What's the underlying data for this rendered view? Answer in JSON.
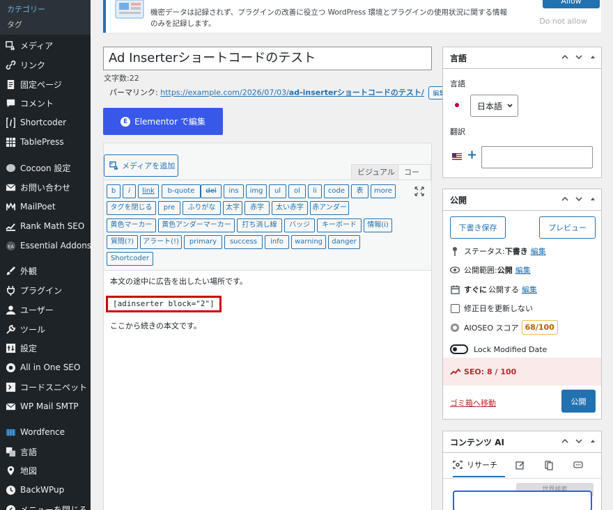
{
  "sidebar": {
    "submenu": [
      {
        "label": "カテゴリー",
        "active": true
      },
      {
        "label": "タグ",
        "active": false
      }
    ],
    "items": [
      {
        "label": "メディア",
        "icon": "media-icon"
      },
      {
        "label": "リンク",
        "icon": "link-icon"
      },
      {
        "label": "固定ページ",
        "icon": "page-icon"
      },
      {
        "label": "コメント",
        "icon": "comment-icon"
      },
      {
        "label": "Shortcoder",
        "icon": "shortcode-icon"
      },
      {
        "label": "TablePress",
        "icon": "table-icon"
      },
      {
        "label": "Cocoon 設定",
        "icon": "cocoon-icon"
      },
      {
        "label": "お問い合わせ",
        "icon": "mail-icon"
      },
      {
        "label": "MailPoet",
        "icon": "mailpoet-icon"
      },
      {
        "label": "Rank Math SEO",
        "icon": "rankmath-icon"
      },
      {
        "label": "Essential Addons",
        "icon": "ea-icon"
      },
      {
        "label": "外観",
        "icon": "brush-icon"
      },
      {
        "label": "プラグイン",
        "icon": "plugin-icon"
      },
      {
        "label": "ユーザー",
        "icon": "user-icon"
      },
      {
        "label": "ツール",
        "icon": "wrench-icon"
      },
      {
        "label": "設定",
        "icon": "settings-icon"
      },
      {
        "label": "All in One SEO",
        "icon": "aioseo-icon"
      },
      {
        "label": "コードスニペット",
        "icon": "snippet-icon"
      },
      {
        "label": "WP Mail SMTP",
        "icon": "smtp-icon"
      },
      {
        "label": "Wordfence",
        "icon": "wordfence-icon"
      },
      {
        "label": "言語",
        "icon": "translate-icon"
      },
      {
        "label": "地図",
        "icon": "map-pin-icon"
      },
      {
        "label": "BackWPup",
        "icon": "backwpup-icon"
      },
      {
        "label": "メニューを閉じる",
        "icon": "collapse-icon"
      }
    ]
  },
  "notice": {
    "text": "機密データは記録されず、プラグインの改善に役立つ WordPress 環境とプラグインの使用状況に関する情報のみを記録します。",
    "allow_label": "Allow",
    "deny_label": "Do not allow"
  },
  "post": {
    "title": "Ad Inserterショートコードのテスト",
    "word_count": "文字数:22",
    "permalink_label": "パーマリンク:",
    "permalink_base": "https://example.com/2026/07/03/",
    "permalink_slug": "ad-inserterショートコードのテスト/",
    "permalink_edit": "編集"
  },
  "elementor": {
    "label": "Elementor で編集",
    "logo": "E"
  },
  "editor": {
    "media_button": "メディアを追加",
    "tab_visual": "ビジュアル",
    "tab_code": "コード",
    "quicktags": [
      [
        "b",
        "i",
        "link",
        "b-quote",
        "del",
        "ins",
        "img",
        "ul",
        "ol",
        "li",
        "code",
        "表",
        "more"
      ],
      [
        "タグを閉じる",
        "pre",
        "ふりがな",
        "太字",
        "赤字",
        "太い赤字",
        "赤アンダー"
      ],
      [
        "黄色マーカー",
        "黄色アンダーマーカー",
        "打ち消し線",
        "バッジ",
        "キーボード",
        "情報(i)"
      ],
      [
        "質問(?)",
        "アラート(!)",
        "primary",
        "success",
        "info",
        "warning",
        "danger"
      ],
      [
        "Shortcoder"
      ]
    ],
    "content": {
      "line1": "本文の途中に広告を出したい場所です。",
      "shortcode": "[adinserter block=\"2\"]",
      "line3": "ここから続きの本文です。"
    }
  },
  "language_panel": {
    "title": "言語",
    "language_label": "言語",
    "language_value": "日本語",
    "translation_label": "翻訳",
    "add_symbol": "+"
  },
  "publish_panel": {
    "title": "公開",
    "save_draft": "下書き保存",
    "preview": "プレビュー",
    "status_label": "ステータス:",
    "status_value": "下書き",
    "visibility_label": "公開範囲:",
    "visibility_value": "公開",
    "schedule_value": "すぐに",
    "schedule_label": "公開する",
    "edit_label": "編集",
    "no_update_modified": "修正日を更新しない",
    "aioseo_label": "AIOSEO スコア",
    "aioseo_score": "68/100",
    "lock_modified": "Lock Modified Date",
    "seo_score": "SEO: 8 / 100",
    "trash": "ゴミ箱へ移動",
    "publish": "公開"
  },
  "content_ai": {
    "title": "コンテンツ AI",
    "tab_research": "リサーチ",
    "grey_text": "世界検索"
  },
  "colors": {
    "accent": "#2271b1",
    "sidebar_bg": "#1d2327",
    "elementor": "#3858e9",
    "seo_bad": "#b32d2e"
  }
}
